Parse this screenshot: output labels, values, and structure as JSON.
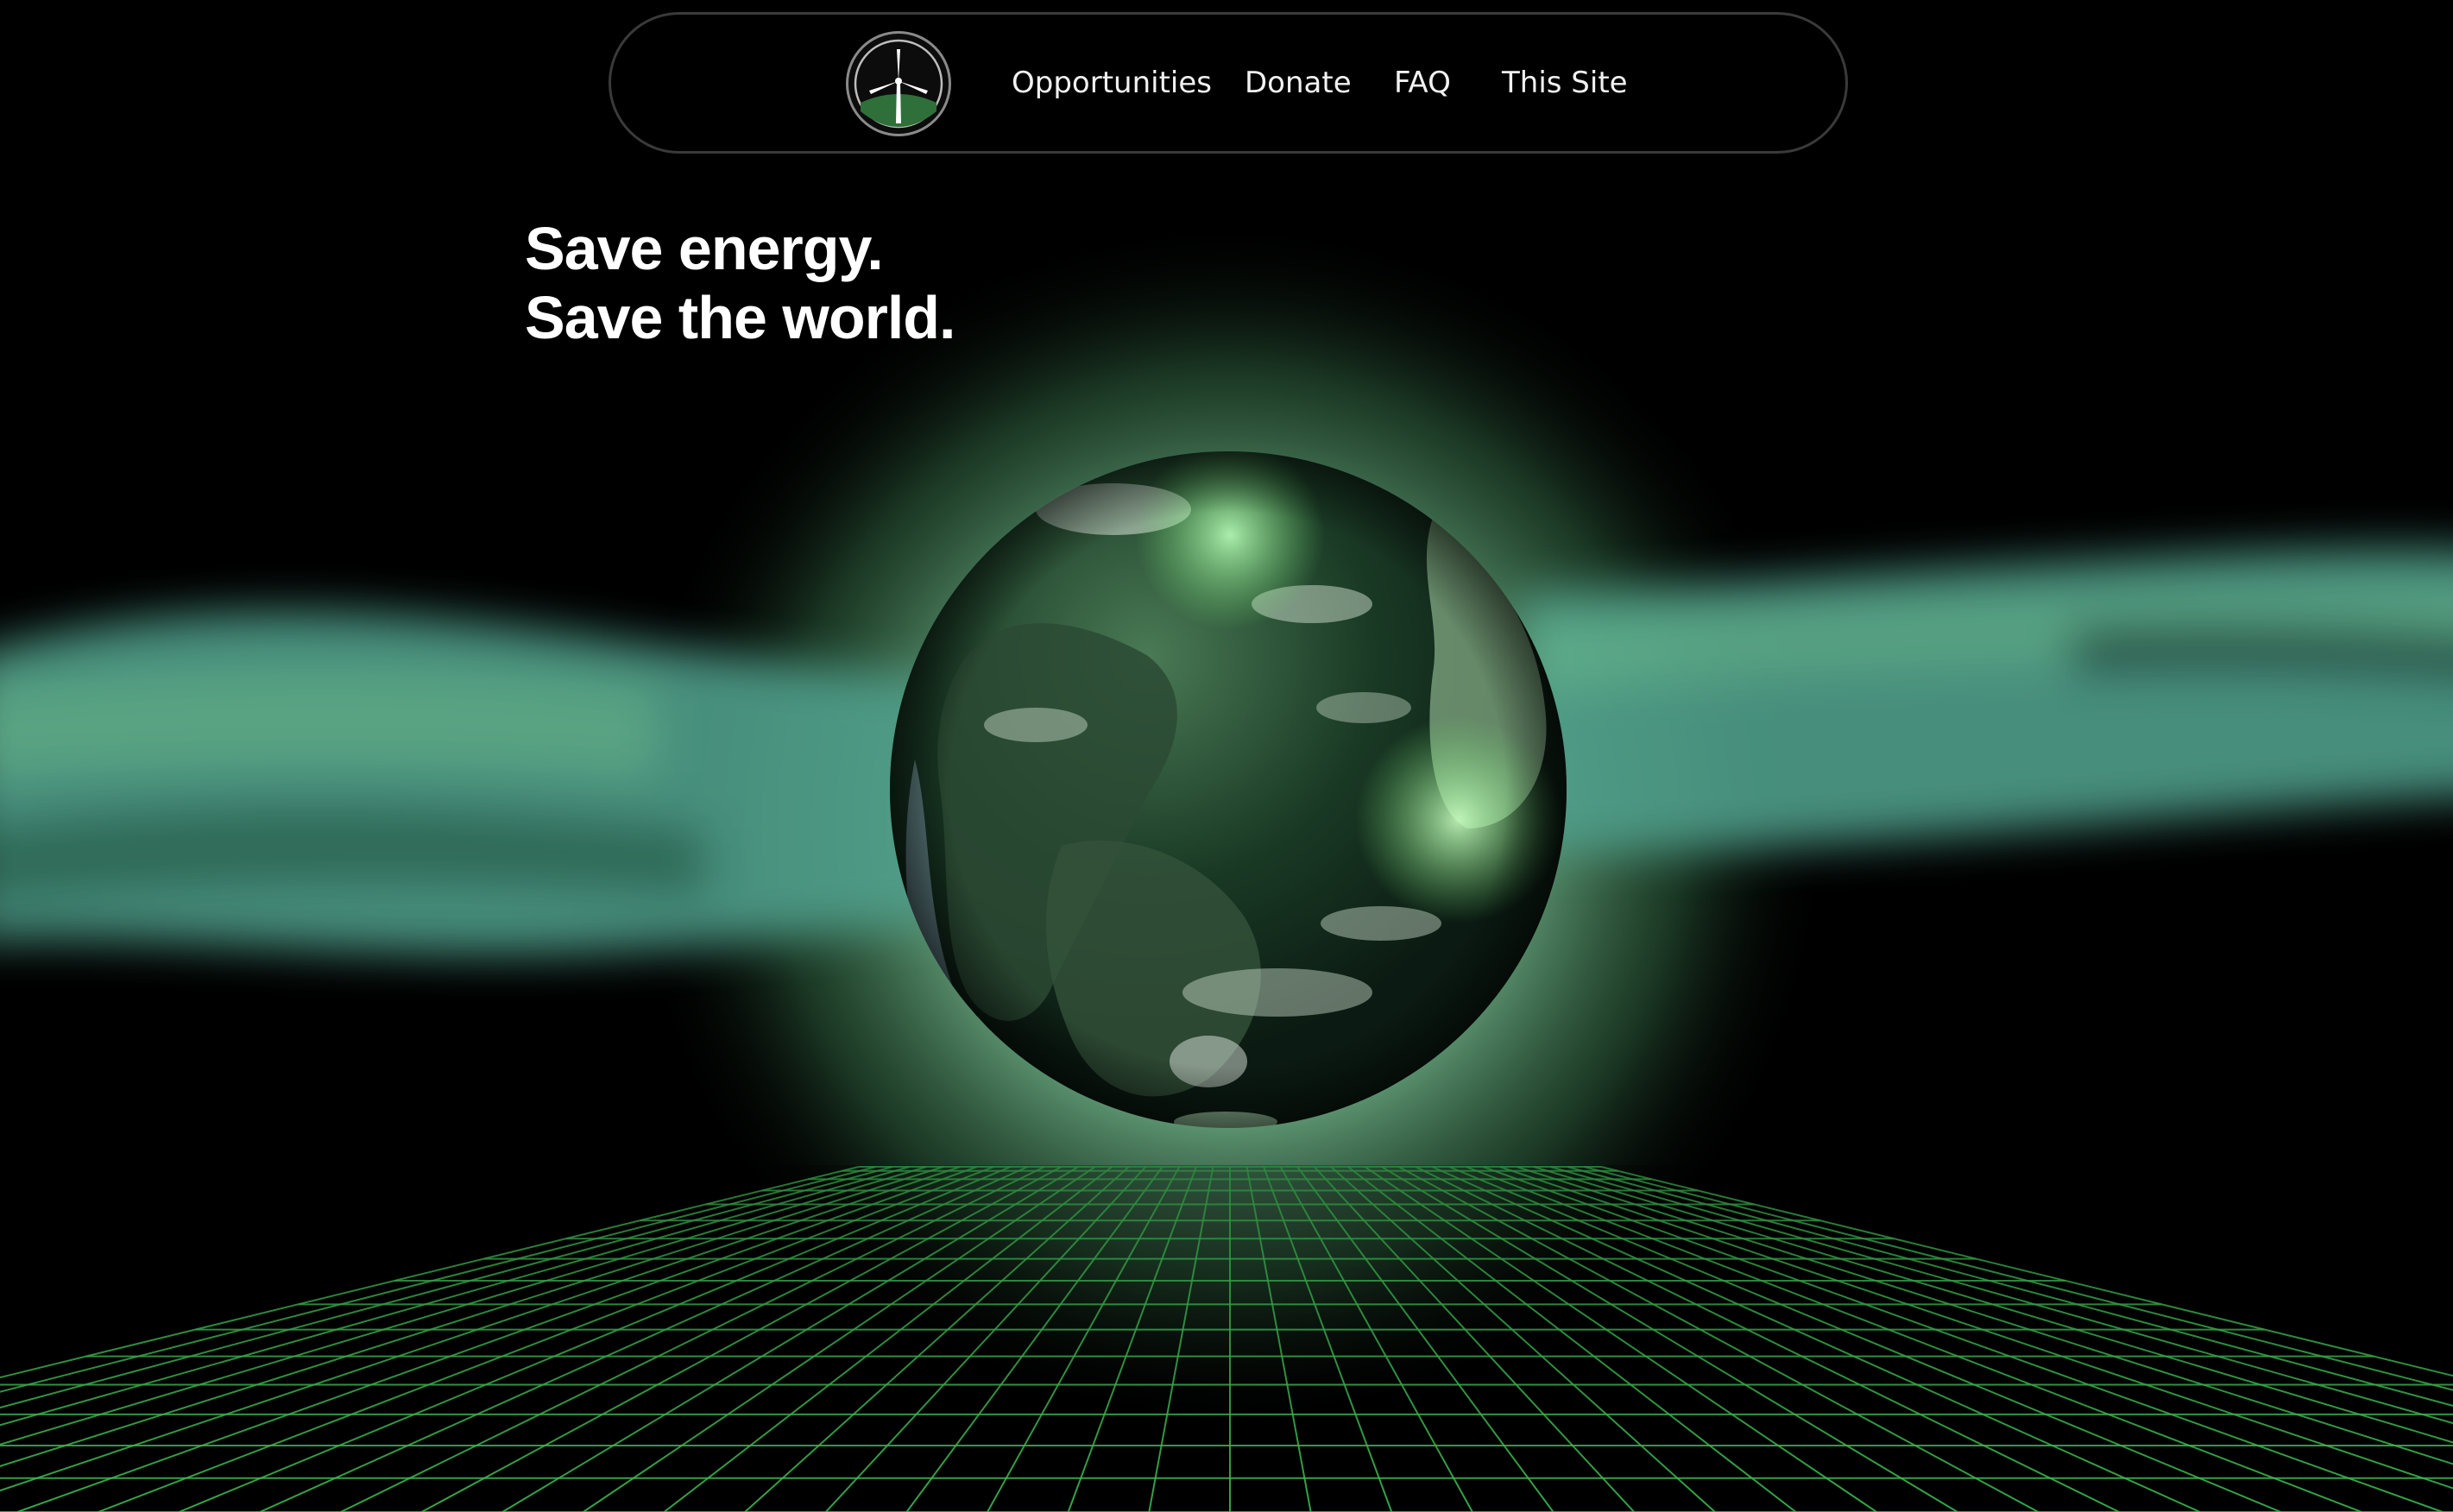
{
  "nav": {
    "logo_icon": "wind-turbine-icon",
    "items": [
      {
        "label": "Opportunities"
      },
      {
        "label": "Donate"
      },
      {
        "label": "FAQ"
      },
      {
        "label": "This Site"
      }
    ]
  },
  "hero": {
    "line1": "Save energy.",
    "line2": "Save the world."
  },
  "colors": {
    "background": "#000000",
    "accent_green": "#3fbf55",
    "glow_green": "#7fc79a",
    "ribbon_teal": "#4f9e8a",
    "text": "#ffffff"
  }
}
